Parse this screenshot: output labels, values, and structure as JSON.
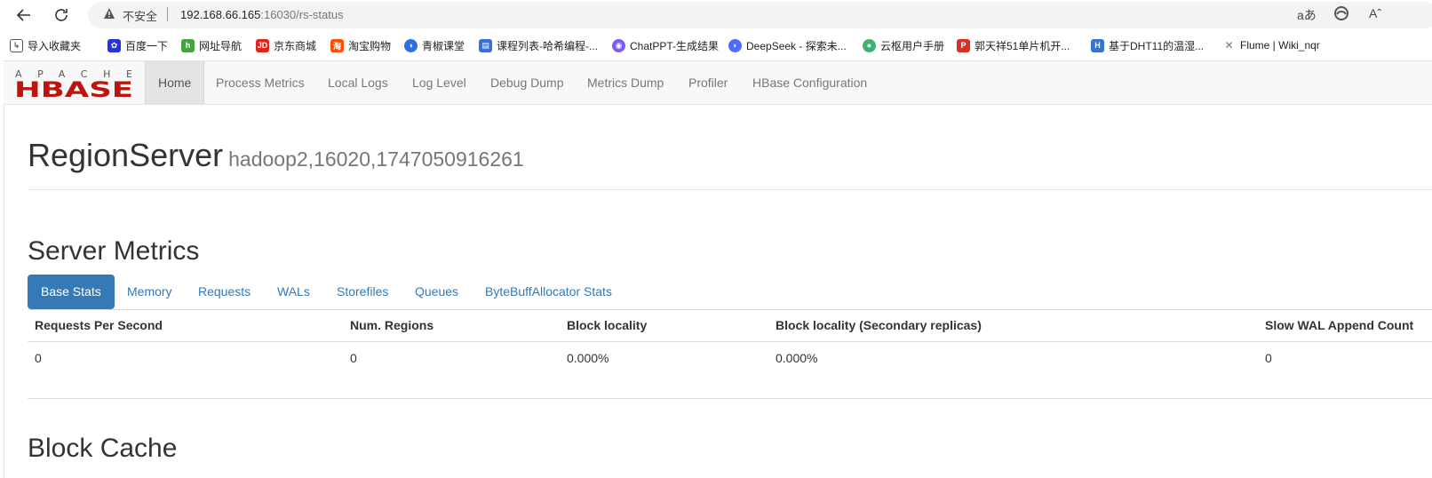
{
  "browser": {
    "insecure_label": "不安全",
    "url_host": "192.168.66.165",
    "url_rest": ":16030/rs-status",
    "read_aloud": "aあ",
    "font_size": "Aˆ"
  },
  "bookmarks": [
    {
      "label": "导入收藏夹",
      "icon": "import-icon",
      "color": "#555555"
    },
    {
      "label": "百度一下",
      "icon": "baidu-icon",
      "color": "#2932e1"
    },
    {
      "label": "网址导航",
      "icon": "hao-icon",
      "color": "#48a23f"
    },
    {
      "label": "京东商城",
      "icon": "jd-icon",
      "color": "#e1251b"
    },
    {
      "label": "淘宝购物",
      "icon": "taobao-icon",
      "color": "#ff5000"
    },
    {
      "label": "青椒课堂",
      "icon": "qingjiao-icon",
      "color": "#2f6fe4"
    },
    {
      "label": "课程列表-哈希编程-...",
      "icon": "course-icon",
      "color": "#3b6fd8"
    },
    {
      "label": "ChatPPT-生成结果",
      "icon": "chatppt-icon",
      "color": "#7b5cf0"
    },
    {
      "label": "DeepSeek - 探索未...",
      "icon": "deepseek-icon",
      "color": "#4d6bfe"
    },
    {
      "label": "云枢用户手册",
      "icon": "yunshu-icon",
      "color": "#3cb371"
    },
    {
      "label": "郭天祥51单片机开...",
      "icon": "pdf-icon",
      "color": "#d93025"
    },
    {
      "label": "基于DHT11的温湿...",
      "icon": "doc-icon",
      "color": "#3a73c8"
    },
    {
      "label": "Flume | Wiki_nqr",
      "icon": "flume-icon",
      "color": "#6b7b8c"
    }
  ],
  "navbar": {
    "logo_top": "APACHE",
    "logo_bottom": "HBASE",
    "items": [
      "Home",
      "Process Metrics",
      "Local Logs",
      "Log Level",
      "Debug Dump",
      "Metrics Dump",
      "Profiler",
      "HBase Configuration"
    ]
  },
  "page": {
    "title": "RegionServer",
    "server_name": "hadoop2,16020,1747050916261",
    "server_metrics_heading": "Server Metrics",
    "block_cache_heading": "Block Cache"
  },
  "tabs": [
    "Base Stats",
    "Memory",
    "Requests",
    "WALs",
    "Storefiles",
    "Queues",
    "ByteBuffAllocator Stats"
  ],
  "table": {
    "headers": [
      "Requests Per Second",
      "Num. Regions",
      "Block locality",
      "Block locality (Secondary replicas)",
      "Slow WAL Append Count"
    ],
    "rows": [
      [
        "0",
        "0",
        "0.000%",
        "0.000%",
        "0"
      ]
    ]
  },
  "colors": {
    "accent": "#337ab7",
    "hbase_red": "#ba160c"
  }
}
